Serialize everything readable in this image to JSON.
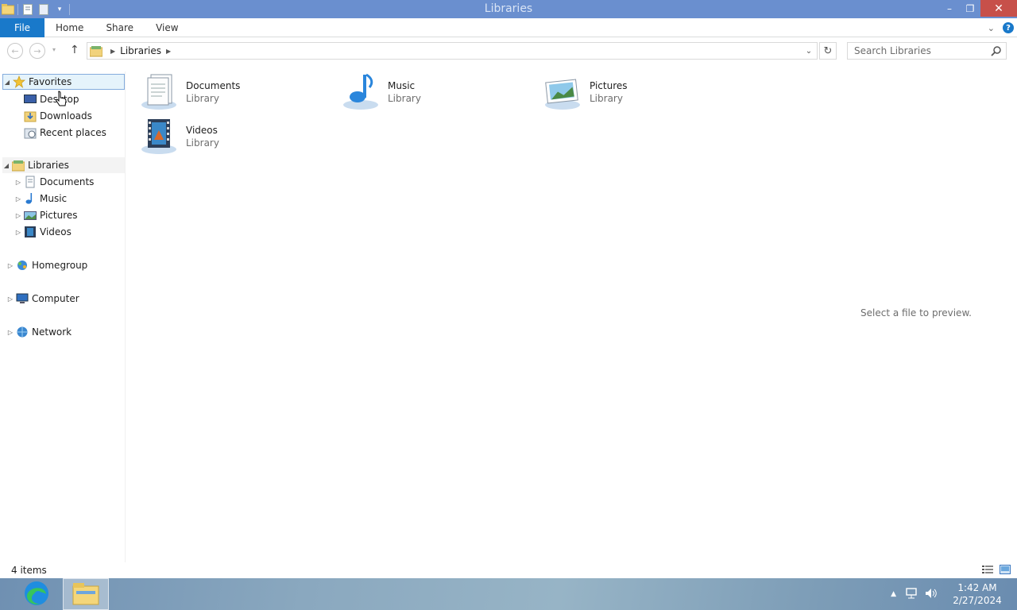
{
  "window": {
    "title": "Libraries",
    "minimize_label": "–",
    "restore_label": "❐",
    "close_label": "✕"
  },
  "ribbon": {
    "tabs": [
      {
        "label": "File"
      },
      {
        "label": "Home"
      },
      {
        "label": "Share"
      },
      {
        "label": "View"
      }
    ],
    "help_label": "?"
  },
  "address": {
    "path": [
      "Libraries"
    ],
    "search_placeholder": "Search Libraries"
  },
  "nav_pane": {
    "favorites": {
      "label": "Favorites",
      "items": [
        {
          "label": "Desktop"
        },
        {
          "label": "Downloads"
        },
        {
          "label": "Recent places"
        }
      ]
    },
    "libraries": {
      "label": "Libraries",
      "items": [
        {
          "label": "Documents"
        },
        {
          "label": "Music"
        },
        {
          "label": "Pictures"
        },
        {
          "label": "Videos"
        }
      ]
    },
    "homegroup": {
      "label": "Homegroup"
    },
    "computer": {
      "label": "Computer"
    },
    "network": {
      "label": "Network"
    }
  },
  "content": {
    "libraries": [
      {
        "name": "Documents",
        "type": "Library",
        "icon": "documents-library-icon"
      },
      {
        "name": "Music",
        "type": "Library",
        "icon": "music-library-icon"
      },
      {
        "name": "Pictures",
        "type": "Library",
        "icon": "pictures-library-icon"
      },
      {
        "name": "Videos",
        "type": "Library",
        "icon": "videos-library-icon"
      }
    ],
    "preview_text": "Select a file to preview."
  },
  "status": {
    "item_count": "4 items"
  },
  "taskbar": {
    "time": "1:42 AM",
    "date": "2/27/2024"
  },
  "colors": {
    "titlebar": "#6a8fcf",
    "file_tab": "#1979ca",
    "close_button": "#c7504a",
    "selection": "#e5f3fb"
  }
}
